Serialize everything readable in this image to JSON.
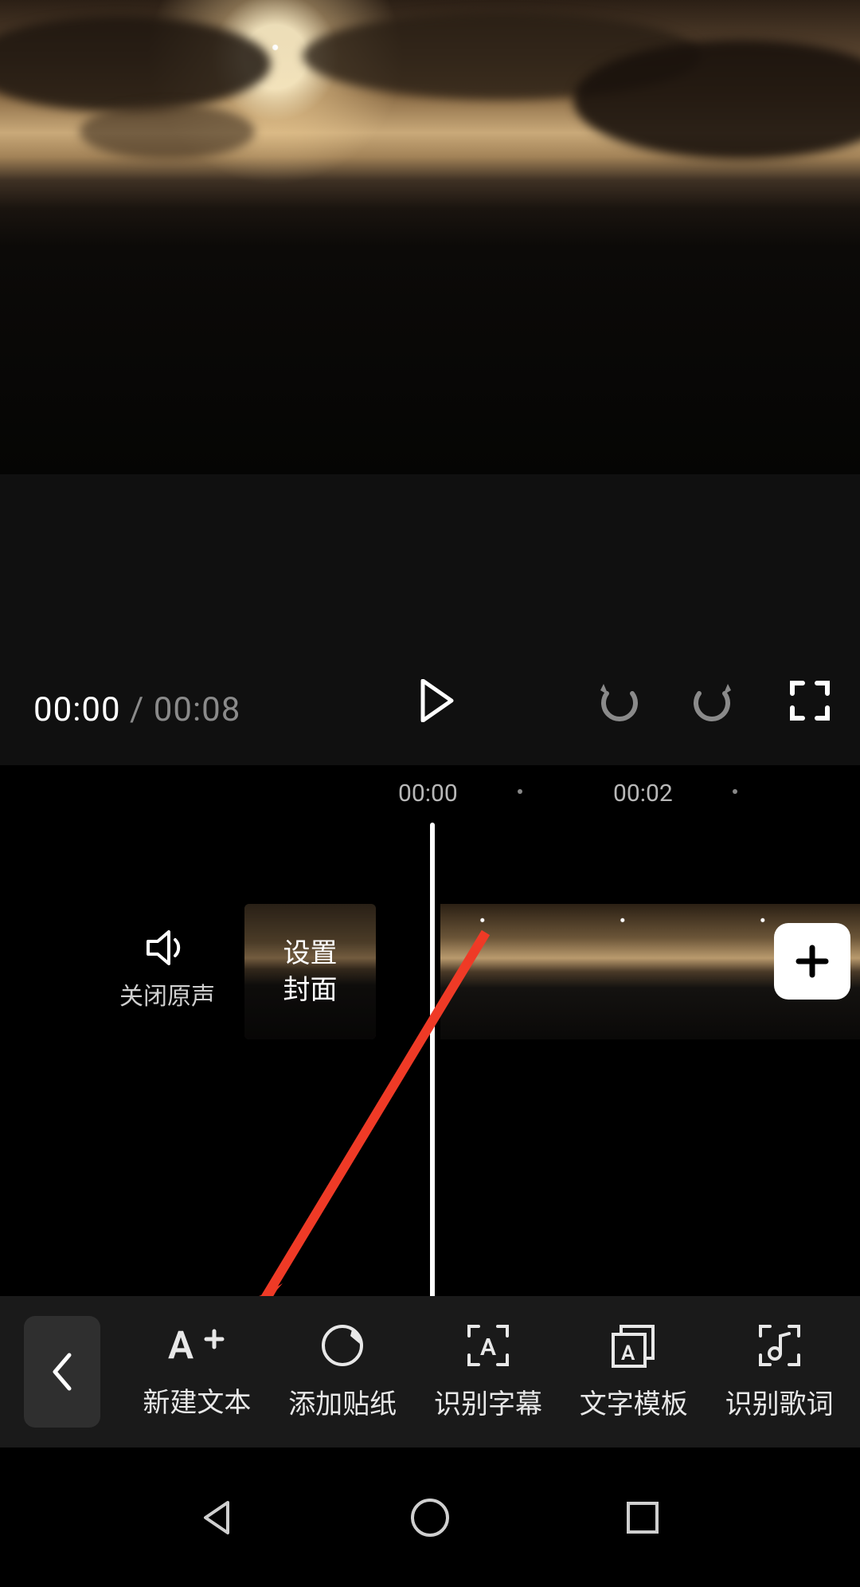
{
  "playback": {
    "current": "00:00",
    "separator": " / ",
    "duration": "00:08"
  },
  "ruler": {
    "t0": "00:00",
    "t2": "00:02"
  },
  "mute": {
    "label": "关闭原声"
  },
  "cover": {
    "line1": "设置",
    "line2": "封面"
  },
  "toolbar": {
    "new_text": "新建文本",
    "add_sticker": "添加贴纸",
    "auto_caption": "识别字幕",
    "text_template": "文字模板",
    "recognize_lyrics": "识别歌词"
  }
}
